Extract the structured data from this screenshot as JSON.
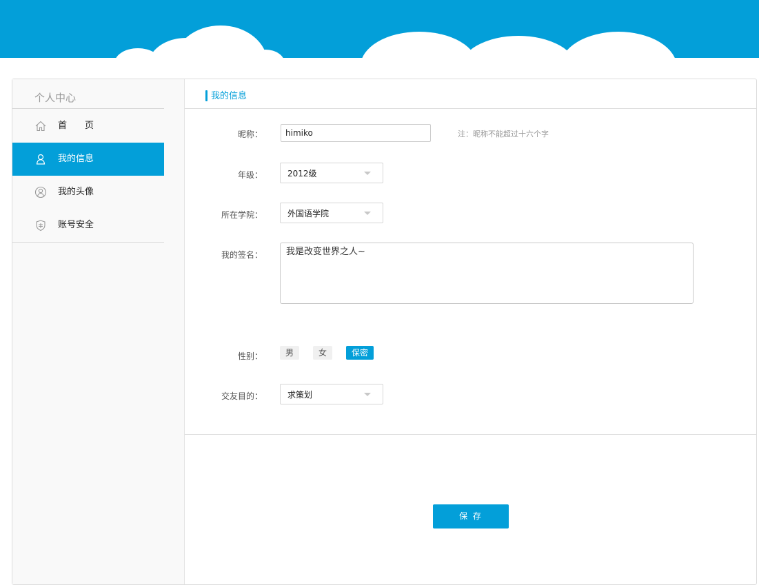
{
  "sidebar": {
    "title": "个人中心",
    "items": [
      {
        "label": "首　　页",
        "icon": "home-icon"
      },
      {
        "label": "我的信息",
        "icon": "user-icon"
      },
      {
        "label": "我的头像",
        "icon": "avatar-icon"
      },
      {
        "label": "账号安全",
        "icon": "shield-icon"
      }
    ]
  },
  "main": {
    "title": "我的信息",
    "nickname": {
      "label": "昵称：",
      "value": "himiko",
      "note": "注：昵称不能超过十六个字"
    },
    "grade": {
      "label": "年级：",
      "value": "2012级"
    },
    "college": {
      "label": "所在学院：",
      "value": "外国语学院"
    },
    "signature": {
      "label": "我的签名：",
      "value": "我是改变世界之人~"
    },
    "gender": {
      "label": "性别：",
      "options": [
        "男",
        "女",
        "保密"
      ],
      "selected": "保密"
    },
    "purpose": {
      "label": "交友目的：",
      "value": "求策划"
    },
    "save_label": "保 存"
  },
  "colors": {
    "accent": "#039fd9",
    "banner": "#039fd9",
    "sidebar_bg": "#f9f9f9"
  }
}
